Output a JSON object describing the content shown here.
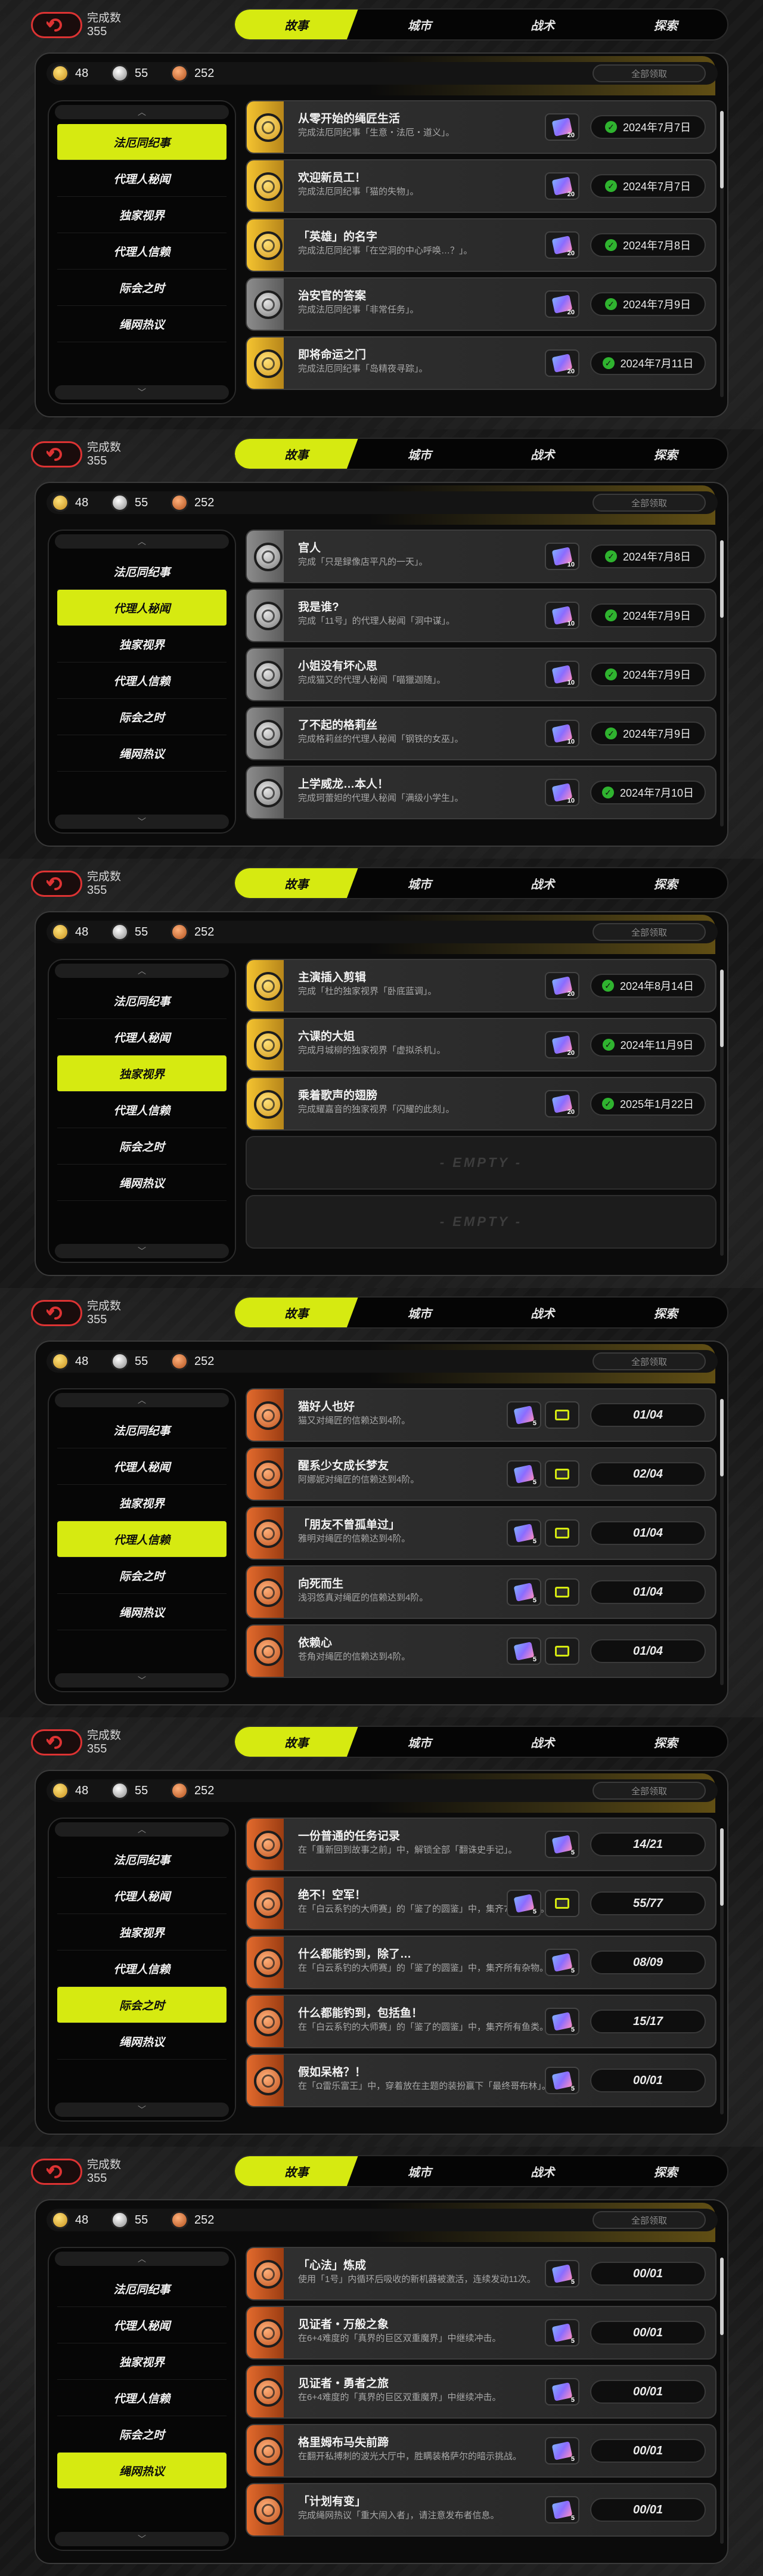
{
  "header": {
    "count_label": "完成数",
    "count_value": "355",
    "tabs": [
      "故事",
      "城市",
      "战术",
      "探索"
    ]
  },
  "currency": [
    "48",
    "55",
    "252"
  ],
  "claim_all_label": "全部领取",
  "sidebar_items": [
    "法厄同纪事",
    "代理人秘闻",
    "独家视界",
    "代理人信赖",
    "际会之时",
    "绳网热议"
  ],
  "screens": [
    {
      "active_sidebar": 0,
      "cards": [
        {
          "title": "从零开始的绳匠生活",
          "desc": "完成法厄同纪事「生意・法厄・道义」。",
          "medal": "gold",
          "reward": "ticket",
          "reward_count": "20",
          "status": "2024年7月7日",
          "done": true
        },
        {
          "title": "欢迎新员工！",
          "desc": "完成法厄同纪事「猫的失物」。",
          "medal": "gold",
          "reward": "ticket",
          "reward_count": "20",
          "status": "2024年7月7日",
          "done": true
        },
        {
          "title": "「英雄」的名字",
          "desc": "完成法厄同纪事「在空洞的中心呼唤…？」。",
          "medal": "gold",
          "reward": "ticket",
          "reward_count": "20",
          "status": "2024年7月8日",
          "done": true
        },
        {
          "title": "治安官的答案",
          "desc": "完成法厄同纪事「非常任务」。",
          "medal": "gray",
          "reward": "ticket",
          "reward_count": "20",
          "status": "2024年7月9日",
          "done": true
        },
        {
          "title": "即将命运之门",
          "desc": "完成法厄同纪事「岛精夜寻踪」。",
          "medal": "gold",
          "reward": "ticket",
          "reward_count": "20",
          "status": "2024年7月11日",
          "done": true
        }
      ]
    },
    {
      "active_sidebar": 1,
      "cards": [
        {
          "title": "官人",
          "desc": "完成「只是録像店平凡的一天」。",
          "medal": "gray",
          "reward": "ticket",
          "reward_count": "10",
          "status": "2024年7月8日",
          "done": true
        },
        {
          "title": "我是谁?",
          "desc": "完成「11号」的代理人秘闻「洞中谋」。",
          "medal": "gray",
          "reward": "ticket",
          "reward_count": "10",
          "status": "2024年7月9日",
          "done": true
        },
        {
          "title": "小姐没有坏心思",
          "desc": "完成猫又的代理人秘闻「喵獵迦随」。",
          "medal": "gray",
          "reward": "ticket",
          "reward_count": "10",
          "status": "2024年7月9日",
          "done": true
        },
        {
          "title": "了不起的格莉丝",
          "desc": "完成格莉丝的代理人秘闻「钢铁的女巫」。",
          "medal": "gray",
          "reward": "ticket",
          "reward_count": "10",
          "status": "2024年7月9日",
          "done": true
        },
        {
          "title": "上学威龙…本人！",
          "desc": "完成珂蕾妲的代理人秘闻「满级小学生」。",
          "medal": "gray",
          "reward": "ticket",
          "reward_count": "10",
          "status": "2024年7月10日",
          "done": true
        }
      ]
    },
    {
      "active_sidebar": 2,
      "cards": [
        {
          "title": "主演插入剪辑",
          "desc": "完成「杜的独家视界「卧底蓝调」。",
          "medal": "gold",
          "reward": "ticket",
          "reward_count": "20",
          "status": "2024年8月14日",
          "done": true
        },
        {
          "title": "六课的大姐",
          "desc": "完成月城柳的独家视界「虚拟杀机」。",
          "medal": "gold",
          "reward": "ticket",
          "reward_count": "20",
          "status": "2024年11月9日",
          "done": true
        },
        {
          "title": "乘着歌声的翅膀",
          "desc": "完成耀嘉音的独家视界「闪耀的此刻」。",
          "medal": "gold",
          "reward": "ticket",
          "reward_count": "20",
          "status": "2025年1月22日",
          "done": true
        },
        {
          "empty": true,
          "label": "- EMPTY -"
        },
        {
          "empty": true,
          "label": "- EMPTY -"
        }
      ]
    },
    {
      "active_sidebar": 3,
      "cards": [
        {
          "title": "猫好人也好",
          "desc": "猫又对绳匠的信赖达到4阶。",
          "medal": "orange",
          "reward": "ticket+gem",
          "reward_count": "5",
          "status": "01/04",
          "done": false
        },
        {
          "title": "醒系少女成长梦友",
          "desc": "阿娜妮对绳匠的信赖达到4阶。",
          "medal": "orange",
          "reward": "ticket+gem",
          "reward_count": "5",
          "status": "02/04",
          "done": false
        },
        {
          "title": "「朋友不曾孤单过」",
          "desc": "雅明对绳匠的信赖达到4阶。",
          "medal": "orange",
          "reward": "ticket+gem",
          "reward_count": "5",
          "status": "01/04",
          "done": false
        },
        {
          "title": "向死而生",
          "desc": "浅羽悠真对绳匠的信赖达到4阶。",
          "medal": "orange",
          "reward": "ticket+gem",
          "reward_count": "5",
          "status": "01/04",
          "done": false
        },
        {
          "title": "依赖心",
          "desc": "苍角对绳匠的信赖达到4阶。",
          "medal": "orange",
          "reward": "ticket+gem",
          "reward_count": "5",
          "status": "01/04",
          "done": false
        }
      ]
    },
    {
      "active_sidebar": 4,
      "cards": [
        {
          "title": "一份普通的任务记录",
          "desc": "在「重新回到故事之前」中，解锁全部「翻诛史手记」。",
          "medal": "orange",
          "reward": "ticket",
          "reward_count": "5",
          "status": "14/21",
          "done": false
        },
        {
          "title": "绝不！空军！",
          "desc": "在「白云系钓的大师赛」的「鉴了的圆鉴」中，集齐77种鉴钉。",
          "medal": "orange",
          "reward": "ticket+gem",
          "reward_count": "5",
          "status": "55/77",
          "done": false
        },
        {
          "title": "什么都能钓到，除了…",
          "desc": "在「白云系钓的大师赛」的「鉴了的圆鉴」中，集齐所有杂物。",
          "medal": "orange",
          "reward": "ticket",
          "reward_count": "5",
          "status": "08/09",
          "done": false
        },
        {
          "title": "什么都能钓到，包括鱼！",
          "desc": "在「白云系钓的大师赛」的「鉴了的圆鉴」中，集齐所有鱼类。",
          "medal": "orange",
          "reward": "ticket",
          "reward_count": "5",
          "status": "15/17",
          "done": false
        },
        {
          "title": "假如呆格？！",
          "desc": "在「Ω雷乐富王」中，穿着放在主题的装扮赢下「最终哥布林」。",
          "medal": "orange",
          "reward": "ticket",
          "reward_count": "5",
          "status": "00/01",
          "done": false
        }
      ]
    },
    {
      "active_sidebar": 5,
      "cards": [
        {
          "title": "「心法」炼成",
          "desc": "使用「1号」内循环后吸收的新机器被激活，连续发动11次。",
          "medal": "orange",
          "reward": "ticket",
          "reward_count": "5",
          "status": "00/01",
          "done": false
        },
        {
          "title": "见证者・万般之象",
          "desc": "在6+4难度的「真界的巨区双重魔界」中继续冲击。",
          "medal": "orange",
          "reward": "ticket",
          "reward_count": "5",
          "status": "00/01",
          "done": false
        },
        {
          "title": "见证者・勇者之旅",
          "desc": "在6+4难度的「真界的巨区双重魔界」中继续冲击。",
          "medal": "orange",
          "reward": "ticket",
          "reward_count": "5",
          "status": "00/01",
          "done": false
        },
        {
          "title": "格里姆布马失前蹄",
          "desc": "在翻开私搏刺的波光大厅中，胜瞒装格萨尔的暗示挑战。",
          "medal": "orange",
          "reward": "ticket",
          "reward_count": "5",
          "status": "00/01",
          "done": false
        },
        {
          "title": "「计划有变」",
          "desc": "完成绳网热议「重大闹入者」，请注意发布者信息。",
          "medal": "orange",
          "reward": "ticket",
          "reward_count": "5",
          "status": "00/01",
          "done": false
        }
      ]
    }
  ],
  "icons": {
    "back": "back-arrow-icon",
    "check": "check-icon",
    "medal": "medal-icon",
    "ticket": "ticket-icon",
    "gem": "gem-icon"
  },
  "colors": {
    "accent": "#d6ea11",
    "gold": "#f4c330",
    "orange": "#e26a2d",
    "gray": "#8c8c8c",
    "check": "#2fb32f",
    "back_red": "#dd3333"
  }
}
